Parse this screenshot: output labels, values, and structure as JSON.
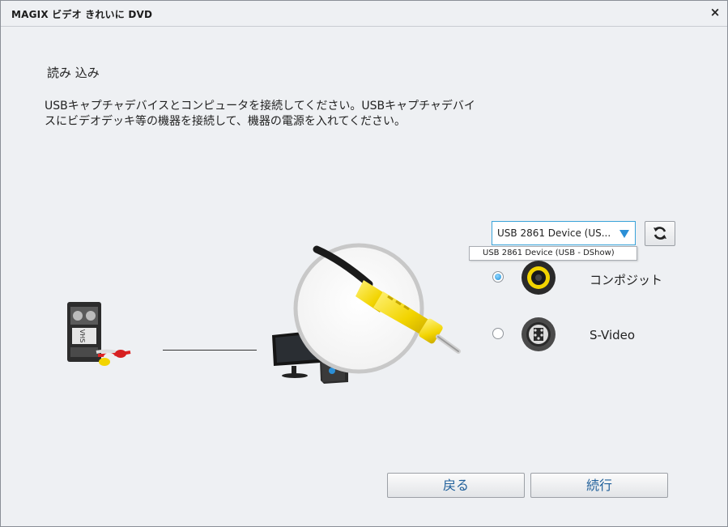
{
  "window": {
    "title": "MAGIX ビデオ きれいに DVD",
    "close_label": "×"
  },
  "page": {
    "heading": "読み 込み",
    "instructions_line1": "USBキャプチャデバイスとコンピュータを接続してください。USBキャプチャデバイ",
    "instructions_line2": "スにビデオデッキ等の機器を接続して、機器の電源を入れてください。"
  },
  "device": {
    "selected": "USB 2861 Device (US...",
    "options": [
      "USB 2861 Device (USB - DShow)"
    ]
  },
  "inputs": [
    {
      "label": "コンポジット",
      "selected": true
    },
    {
      "label": "S-Video",
      "selected": false
    }
  ],
  "buttons": {
    "back": "戻る",
    "continue": "続行"
  },
  "colors": {
    "accent": "#2b8fd6",
    "rca_yellow": "#f2d400",
    "button_text": "#1f5f9a"
  }
}
